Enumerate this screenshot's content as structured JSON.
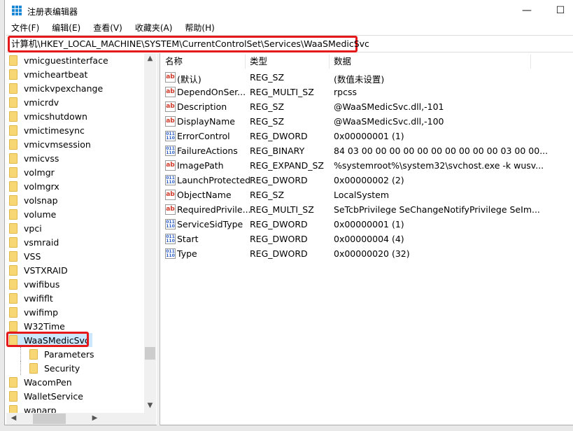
{
  "window": {
    "title": "注册表编辑器",
    "minimize": "—",
    "maximize": "☐"
  },
  "menu": [
    "文件(F)",
    "编辑(E)",
    "查看(V)",
    "收藏夹(A)",
    "帮助(H)"
  ],
  "address": "计算机\\HKEY_LOCAL_MACHINE\\SYSTEM\\CurrentControlSet\\Services\\WaaSMedicSvc",
  "tree": {
    "items": [
      {
        "label": "vmicguestinterface",
        "level": 0
      },
      {
        "label": "vmicheartbeat",
        "level": 0
      },
      {
        "label": "vmickvpexchange",
        "level": 0
      },
      {
        "label": "vmicrdv",
        "level": 0
      },
      {
        "label": "vmicshutdown",
        "level": 0
      },
      {
        "label": "vmictimesync",
        "level": 0
      },
      {
        "label": "vmicvmsession",
        "level": 0
      },
      {
        "label": "vmicvss",
        "level": 0
      },
      {
        "label": "volmgr",
        "level": 0
      },
      {
        "label": "volmgrx",
        "level": 0
      },
      {
        "label": "volsnap",
        "level": 0
      },
      {
        "label": "volume",
        "level": 0
      },
      {
        "label": "vpci",
        "level": 0
      },
      {
        "label": "vsmraid",
        "level": 0
      },
      {
        "label": "VSS",
        "level": 0
      },
      {
        "label": "VSTXRAID",
        "level": 0
      },
      {
        "label": "vwifibus",
        "level": 0
      },
      {
        "label": "vwififlt",
        "level": 0
      },
      {
        "label": "vwifimp",
        "level": 0
      },
      {
        "label": "W32Time",
        "level": 0
      },
      {
        "label": "WaaSMedicSvc",
        "level": 0,
        "selected": true
      },
      {
        "label": "Parameters",
        "level": 1
      },
      {
        "label": "Security",
        "level": 1
      },
      {
        "label": "WacomPen",
        "level": 0
      },
      {
        "label": "WalletService",
        "level": 0
      },
      {
        "label": "wanarp",
        "level": 0
      }
    ]
  },
  "columns": [
    "名称",
    "类型",
    "数据"
  ],
  "values": [
    {
      "icon": "string",
      "name": "(默认)",
      "type": "REG_SZ",
      "data": "(数值未设置)"
    },
    {
      "icon": "string",
      "name": "DependOnSer...",
      "type": "REG_MULTI_SZ",
      "data": "rpcss"
    },
    {
      "icon": "string",
      "name": "Description",
      "type": "REG_SZ",
      "data": "@WaaSMedicSvc.dll,-101"
    },
    {
      "icon": "string",
      "name": "DisplayName",
      "type": "REG_SZ",
      "data": "@WaaSMedicSvc.dll,-100"
    },
    {
      "icon": "binary",
      "name": "ErrorControl",
      "type": "REG_DWORD",
      "data": "0x00000001 (1)"
    },
    {
      "icon": "binary",
      "name": "FailureActions",
      "type": "REG_BINARY",
      "data": "84 03 00 00 00 00 00 00 00 00 00 00 03 00 00..."
    },
    {
      "icon": "string",
      "name": "ImagePath",
      "type": "REG_EXPAND_SZ",
      "data": "%systemroot%\\system32\\svchost.exe -k wusv..."
    },
    {
      "icon": "binary",
      "name": "LaunchProtected",
      "type": "REG_DWORD",
      "data": "0x00000002 (2)"
    },
    {
      "icon": "string",
      "name": "ObjectName",
      "type": "REG_SZ",
      "data": "LocalSystem"
    },
    {
      "icon": "string",
      "name": "RequiredPrivile...",
      "type": "REG_MULTI_SZ",
      "data": "SeTcbPrivilege SeChangeNotifyPrivilege SeIm..."
    },
    {
      "icon": "binary",
      "name": "ServiceSidType",
      "type": "REG_DWORD",
      "data": "0x00000001 (1)"
    },
    {
      "icon": "binary",
      "name": "Start",
      "type": "REG_DWORD",
      "data": "0x00000004 (4)"
    },
    {
      "icon": "binary",
      "name": "Type",
      "type": "REG_DWORD",
      "data": "0x00000020 (32)"
    }
  ],
  "colors": {
    "highlight": "#e51919",
    "selection": "#cce8ff",
    "folder": "#f7d774"
  }
}
